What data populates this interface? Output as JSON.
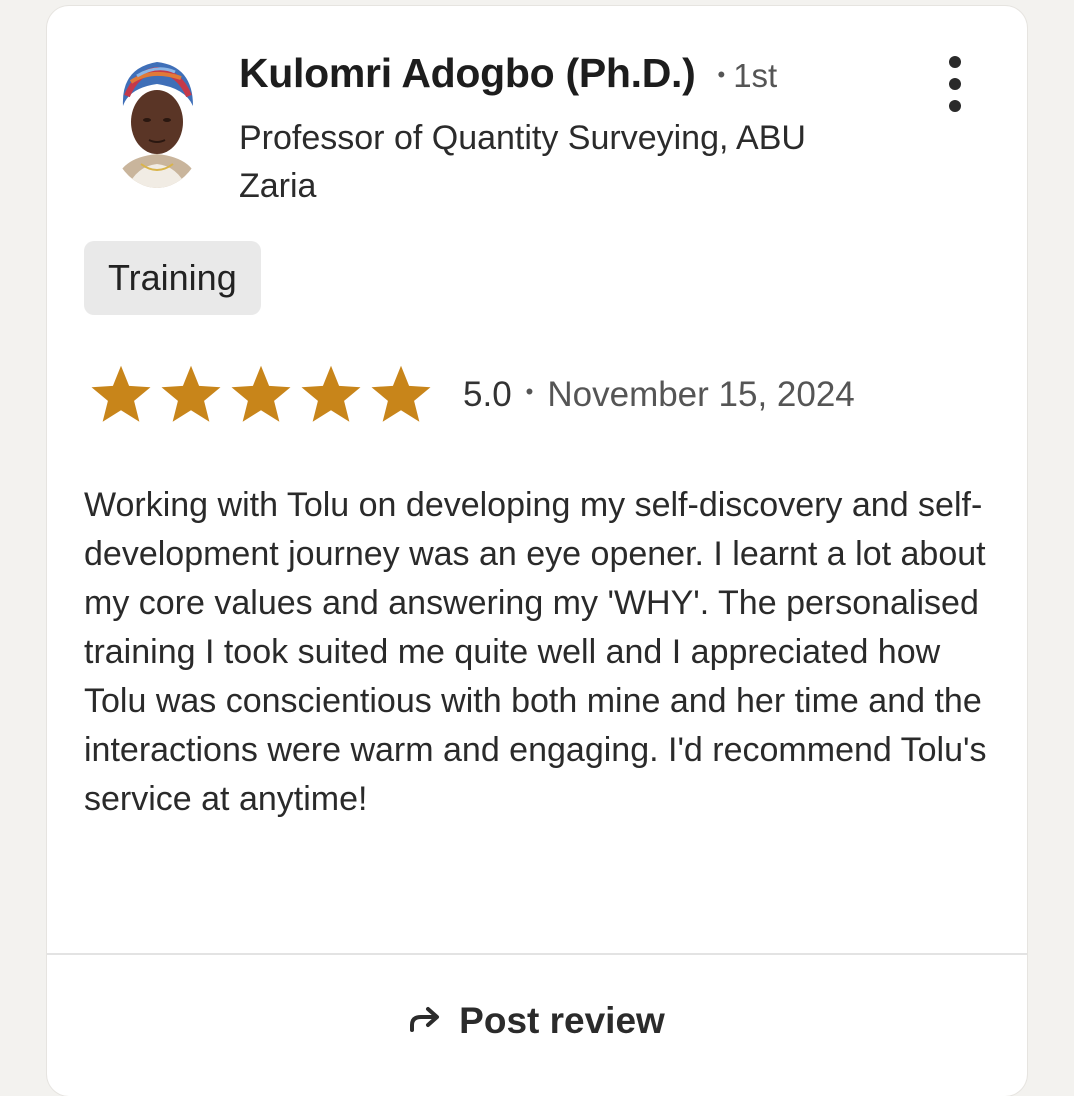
{
  "reviewer": {
    "name": "Kulomri Adogbo (Ph.D.)",
    "degree": "1st",
    "headline": "Professor of Quantity Surveying, ABU Zaria"
  },
  "service_tag": "Training",
  "rating": {
    "value": "5.0",
    "stars": 5,
    "date": "November 15, 2024"
  },
  "review_text": "Working with Tolu on developing my self-discovery and self-development journey was an eye opener. I learnt a lot about my core values and answering my 'WHY'. The personalised training I took suited me quite well and I appreciated how Tolu was conscientious with both mine and her time and the interactions were warm and engaging. I'd recommend Tolu's service at anytime!",
  "actions": {
    "post_review_label": "Post review"
  },
  "colors": {
    "star": "#c8851a",
    "chip_bg": "#e9e9e9",
    "card_bg": "#ffffff"
  },
  "icons": {
    "more": "more-vertical-icon",
    "star": "star-icon",
    "share": "share-arrow-icon"
  }
}
